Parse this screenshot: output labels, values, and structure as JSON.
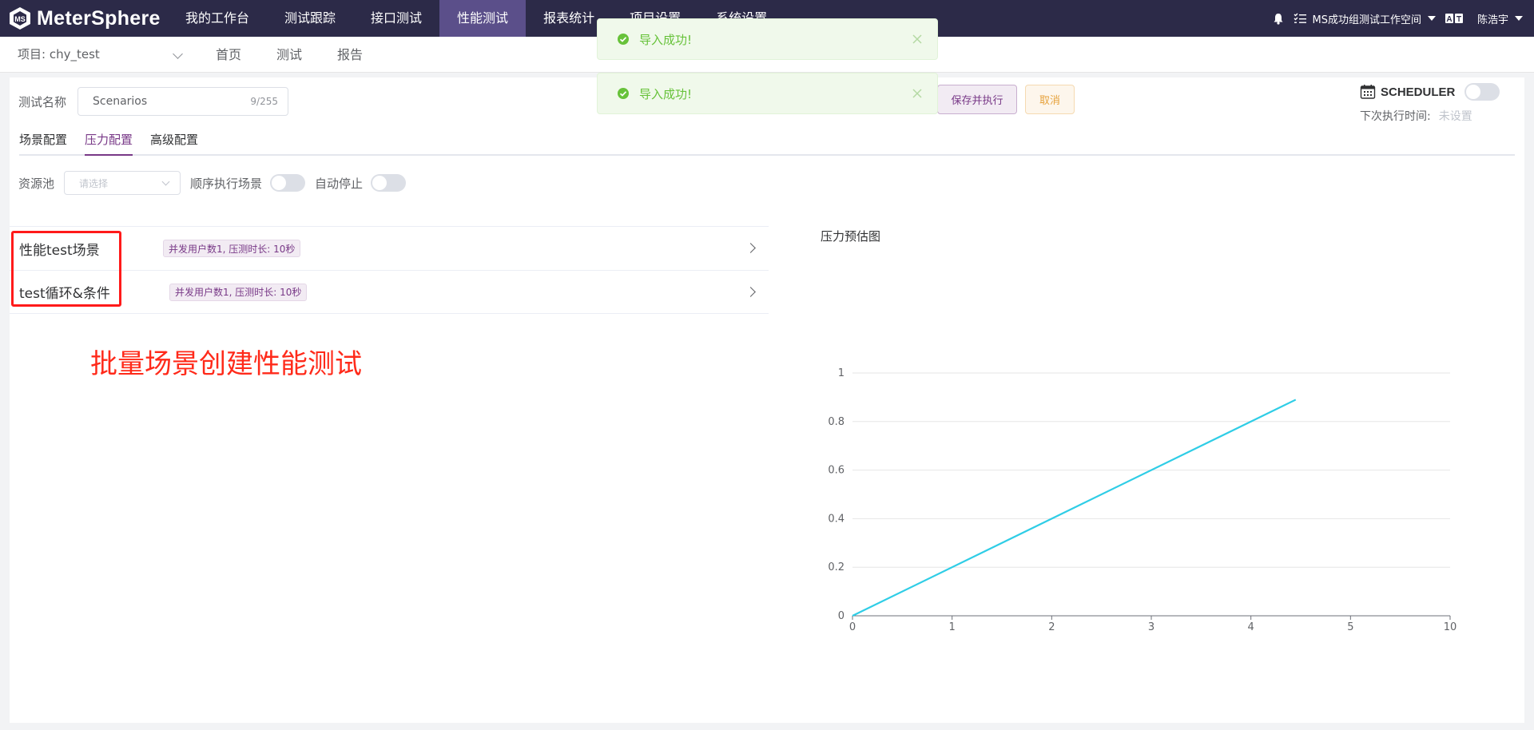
{
  "app": {
    "name": "MeterSphere"
  },
  "nav": {
    "items": [
      "我的工作台",
      "测试跟踪",
      "接口测试",
      "性能测试",
      "报表统计",
      "项目设置",
      "系统设置"
    ],
    "active_index": 3
  },
  "header_tools": {
    "workspace": "MS成功组测试工作空间",
    "language_icon": "language-icon",
    "user": "陈浩宇"
  },
  "subbar": {
    "project": "项目: chy_test",
    "tabs": [
      "首页",
      "测试",
      "报告"
    ]
  },
  "form": {
    "name_label": "测试名称",
    "name_value": "Scenarios",
    "name_count": "9/255",
    "save_run_label": "保存并执行",
    "cancel_label": "取消",
    "scheduler_label": "SCHEDULER",
    "scheduler_enabled": false,
    "next_run_label": "下次执行时间:",
    "next_run_value": "未设置"
  },
  "tabs": {
    "items": [
      "场景配置",
      "压力配置",
      "高级配置"
    ],
    "active_index": 1
  },
  "options": {
    "resource_pool_label": "资源池",
    "resource_pool_placeholder": "请选择",
    "sequential_label": "顺序执行场景",
    "sequential_enabled": false,
    "auto_stop_label": "自动停止",
    "auto_stop_enabled": false
  },
  "scenarios": [
    {
      "name": "性能test场景",
      "tag": "并发用户数1, 压测时长: 10秒"
    },
    {
      "name": "test循环&条件",
      "tag": "并发用户数1, 压测时长: 10秒"
    }
  ],
  "annotation": "批量场景创建性能测试",
  "toasts": [
    "导入成功!",
    "导入成功!"
  ],
  "colors": {
    "topbar": "#2c2a48",
    "accent": "#783887",
    "success": "#67c23a",
    "chart_line": "#2fcde6",
    "annotation": "#ff2a1a"
  },
  "chart_data": {
    "type": "line",
    "title": "压力预估图",
    "x_ticks": [
      "0",
      "1",
      "2",
      "3",
      "4",
      "5",
      "10"
    ],
    "y_ticks": [
      "0",
      "0.2",
      "0.4",
      "0.6",
      "0.8",
      "1"
    ],
    "ylim": [
      0,
      1
    ],
    "series": [
      {
        "x": [
          0,
          4.45
        ],
        "y": [
          0,
          0.89
        ]
      }
    ],
    "grid": true
  }
}
